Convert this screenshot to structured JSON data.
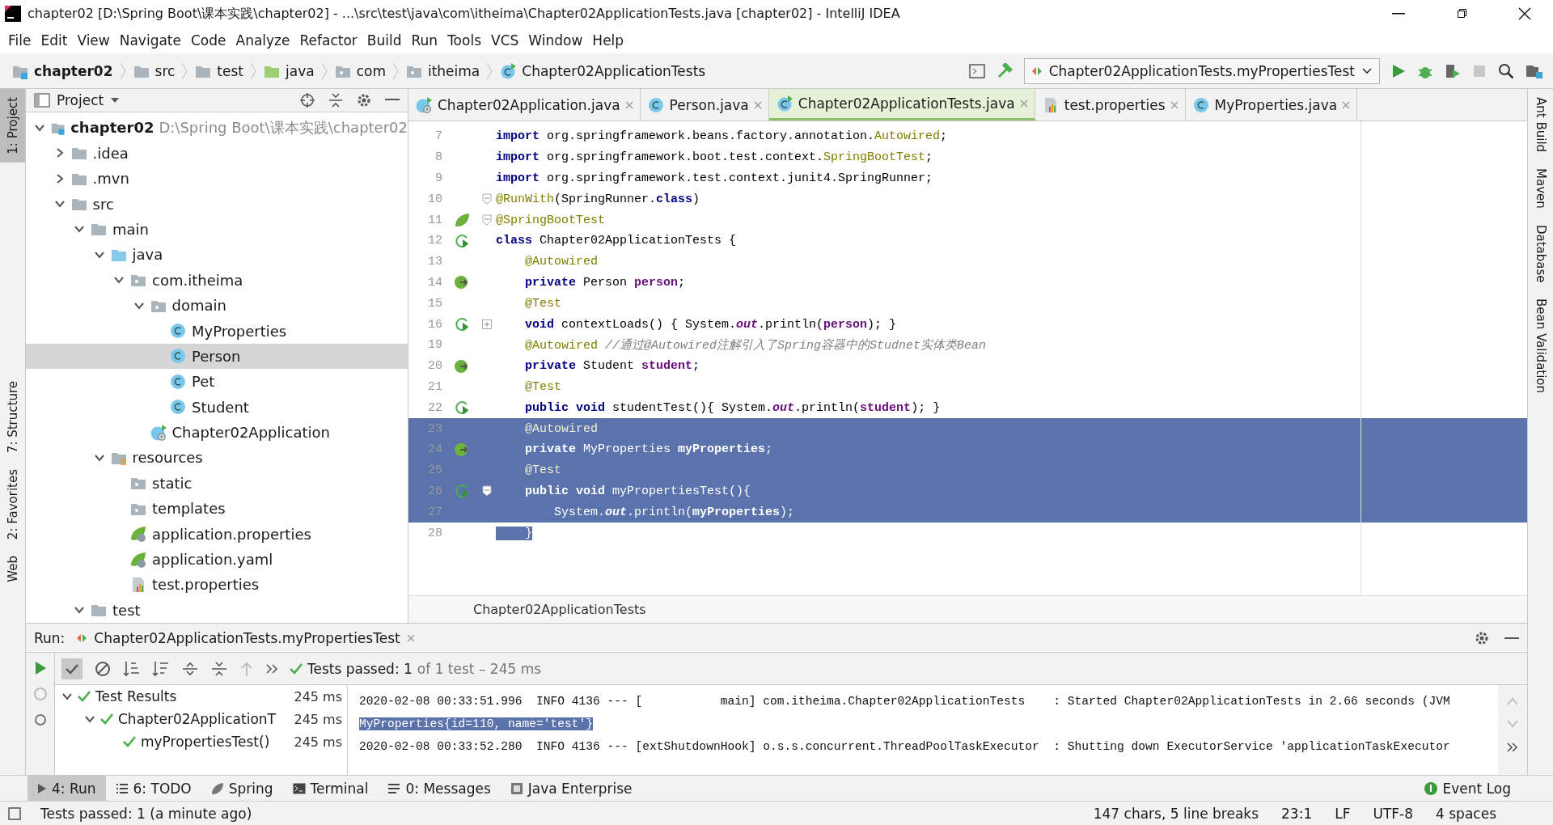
{
  "window": {
    "title": "chapter02 [D:\\Spring Boot\\课本实践\\chapter02] - ...\\src\\test\\java\\com\\itheima\\Chapter02ApplicationTests.java [chapter02] - IntelliJ IDEA"
  },
  "menu": [
    "File",
    "Edit",
    "View",
    "Navigate",
    "Code",
    "Analyze",
    "Refactor",
    "Build",
    "Run",
    "Tools",
    "VCS",
    "Window",
    "Help"
  ],
  "breadcrumbs": [
    {
      "label": "chapter02",
      "kind": "module"
    },
    {
      "label": "src",
      "kind": "folder"
    },
    {
      "label": "test",
      "kind": "folder"
    },
    {
      "label": "java",
      "kind": "testfolder"
    },
    {
      "label": "com",
      "kind": "package"
    },
    {
      "label": "itheima",
      "kind": "package"
    },
    {
      "label": "Chapter02ApplicationTests",
      "kind": "testclass"
    }
  ],
  "run_config": "Chapter02ApplicationTests.myPropertiesTest",
  "left_tools": [
    {
      "label": "1: Project",
      "selected": true
    },
    {
      "label": "7: Structure",
      "selected": false
    },
    {
      "label": "2: Favorites",
      "selected": false
    },
    {
      "label": "Web",
      "selected": false
    }
  ],
  "right_tools": [
    "Ant Build",
    "Maven",
    "Database",
    "Bean Validation"
  ],
  "project": {
    "title": "Project",
    "tree": [
      {
        "label": "chapter02",
        "hint": "D:\\Spring Boot\\课本实践\\chapter02",
        "kind": "module",
        "expanded": true,
        "selected": false,
        "children": [
          {
            "label": ".idea",
            "kind": "folder",
            "expanded": false,
            "selected": false
          },
          {
            "label": ".mvn",
            "kind": "folder",
            "expanded": false,
            "selected": false
          },
          {
            "label": "src",
            "kind": "folder",
            "expanded": true,
            "selected": false,
            "children": [
              {
                "label": "main",
                "kind": "folder",
                "expanded": true,
                "selected": false,
                "children": [
                  {
                    "label": "java",
                    "kind": "sourcefolder",
                    "expanded": true,
                    "selected": false,
                    "children": [
                      {
                        "label": "com.itheima",
                        "kind": "package",
                        "expanded": true,
                        "selected": false,
                        "children": [
                          {
                            "label": "domain",
                            "kind": "package",
                            "expanded": true,
                            "selected": false,
                            "children": [
                              {
                                "label": "MyProperties",
                                "kind": "class",
                                "selected": false
                              },
                              {
                                "label": "Person",
                                "kind": "class",
                                "selected": true
                              },
                              {
                                "label": "Pet",
                                "kind": "class",
                                "selected": false
                              },
                              {
                                "label": "Student",
                                "kind": "class",
                                "selected": false
                              }
                            ]
                          },
                          {
                            "label": "Chapter02Application",
                            "kind": "springclass",
                            "selected": false
                          }
                        ]
                      }
                    ]
                  },
                  {
                    "label": "resources",
                    "kind": "resources",
                    "expanded": true,
                    "selected": false,
                    "children": [
                      {
                        "label": "static",
                        "kind": "package",
                        "selected": false
                      },
                      {
                        "label": "templates",
                        "kind": "package",
                        "selected": false
                      },
                      {
                        "label": "application.properties",
                        "kind": "springconfig",
                        "selected": false
                      },
                      {
                        "label": "application.yaml",
                        "kind": "springconfig",
                        "selected": false
                      },
                      {
                        "label": "test.properties",
                        "kind": "properties",
                        "selected": false
                      }
                    ]
                  }
                ]
              },
              {
                "label": "test",
                "kind": "folder",
                "expanded": true,
                "selected": false
              }
            ]
          }
        ]
      }
    ]
  },
  "editor": {
    "tabs": [
      {
        "label": "Chapter02Application.java",
        "kind": "springclass",
        "selected": false
      },
      {
        "label": "Person.java",
        "kind": "class",
        "selected": false
      },
      {
        "label": "Chapter02ApplicationTests.java",
        "kind": "testclass",
        "selected": true
      },
      {
        "label": "test.properties",
        "kind": "properties",
        "selected": false
      },
      {
        "label": "MyProperties.java",
        "kind": "class",
        "selected": false
      }
    ],
    "lines": [
      {
        "number": "7",
        "selected": false,
        "tokens": [
          {
            "kind": "kw",
            "text": "import"
          },
          {
            "kind": "plain",
            "text": " org.springframework.beans.factory.annotation."
          },
          {
            "kind": "ann",
            "text": "Autowired"
          },
          {
            "kind": "plain",
            "text": ";"
          }
        ]
      },
      {
        "number": "8",
        "selected": false,
        "tokens": [
          {
            "kind": "kw",
            "text": "import"
          },
          {
            "kind": "plain",
            "text": " org.springframework.boot.test.context."
          },
          {
            "kind": "ann",
            "text": "SpringBootTest"
          },
          {
            "kind": "plain",
            "text": ";"
          }
        ]
      },
      {
        "number": "9",
        "selected": false,
        "tokens": [
          {
            "kind": "kw",
            "text": "import"
          },
          {
            "kind": "plain",
            "text": " org.springframework.test.context.junit4.SpringRunner;"
          }
        ]
      },
      {
        "number": "10",
        "selected": false,
        "expanded": true,
        "tokens": [
          {
            "kind": "ann",
            "text": "@RunWith"
          },
          {
            "kind": "plain",
            "text": "(SpringRunner."
          },
          {
            "kind": "kw",
            "text": "class"
          },
          {
            "kind": "plain",
            "text": ")"
          }
        ]
      },
      {
        "number": "11",
        "selected": false,
        "kind": "spring",
        "expanded": true,
        "tokens": [
          {
            "kind": "ann",
            "text": "@SpringBootTest"
          }
        ]
      },
      {
        "number": "12",
        "selected": false,
        "kind": "run",
        "tokens": [
          {
            "kind": "kw",
            "text": "class"
          },
          {
            "kind": "plain",
            "text": " Chapter02ApplicationTests {"
          }
        ]
      },
      {
        "number": "13",
        "selected": false,
        "tokens": [
          {
            "kind": "ann",
            "text": "    @Autowired"
          }
        ]
      },
      {
        "number": "14",
        "selected": false,
        "kind": "bean",
        "tokens": [
          {
            "kind": "kw",
            "text": "    private"
          },
          {
            "kind": "plain",
            "text": " Person "
          },
          {
            "kind": "field",
            "text": "person"
          },
          {
            "kind": "plain",
            "text": ";"
          }
        ]
      },
      {
        "number": "15",
        "selected": false,
        "tokens": [
          {
            "kind": "ann",
            "text": "    @Test"
          }
        ]
      },
      {
        "number": "16",
        "selected": false,
        "kind": "run",
        "expanded": false,
        "tokens": [
          {
            "kind": "kw",
            "text": "    void"
          },
          {
            "kind": "plain",
            "text": " contextLoads() { System."
          },
          {
            "kind": "static",
            "text": "out"
          },
          {
            "kind": "plain",
            "text": ".println("
          },
          {
            "kind": "field",
            "text": "person"
          },
          {
            "kind": "plain",
            "text": "); }"
          }
        ]
      },
      {
        "number": "19",
        "selected": false,
        "tokens": [
          {
            "kind": "ann",
            "text": "    @Autowired"
          },
          {
            "kind": "comment",
            "text": " //通过@Autowired注解引入了Spring容器中的Studnet实体类Bean"
          }
        ]
      },
      {
        "number": "20",
        "selected": false,
        "kind": "bean",
        "tokens": [
          {
            "kind": "kw",
            "text": "    private"
          },
          {
            "kind": "plain",
            "text": " Student "
          },
          {
            "kind": "field",
            "text": "student"
          },
          {
            "kind": "plain",
            "text": ";"
          }
        ]
      },
      {
        "number": "21",
        "selected": false,
        "tokens": [
          {
            "kind": "ann",
            "text": "    @Test"
          }
        ]
      },
      {
        "number": "22",
        "selected": false,
        "kind": "run",
        "tokens": [
          {
            "kind": "kw",
            "text": "    public void"
          },
          {
            "kind": "plain",
            "text": " studentTest(){ System."
          },
          {
            "kind": "static",
            "text": "out"
          },
          {
            "kind": "plain",
            "text": ".println("
          },
          {
            "kind": "field",
            "text": "student"
          },
          {
            "kind": "plain",
            "text": "); }"
          }
        ]
      },
      {
        "number": "23",
        "selected": true,
        "tokens": [
          {
            "kind": "ann",
            "text": "    @Autowired"
          }
        ]
      },
      {
        "number": "24",
        "selected": true,
        "kind": "bean",
        "tokens": [
          {
            "kind": "kw",
            "text": "    private"
          },
          {
            "kind": "plain",
            "text": " MyProperties "
          },
          {
            "kind": "field",
            "text": "myProperties"
          },
          {
            "kind": "plain",
            "text": ";"
          }
        ]
      },
      {
        "number": "25",
        "selected": true,
        "tokens": [
          {
            "kind": "ann",
            "text": "    @Test"
          }
        ]
      },
      {
        "number": "26",
        "selected": true,
        "kind": "run",
        "expanded": true,
        "tokens": [
          {
            "kind": "kw",
            "text": "    public void"
          },
          {
            "kind": "plain",
            "text": " myPropertiesTest(){"
          }
        ]
      },
      {
        "number": "27",
        "selected": true,
        "tokens": [
          {
            "kind": "plain",
            "text": "        System."
          },
          {
            "kind": "static",
            "text": "out"
          },
          {
            "kind": "plain",
            "text": ".println("
          },
          {
            "kind": "field",
            "text": "myProperties"
          },
          {
            "kind": "plain",
            "text": ");"
          }
        ]
      },
      {
        "number": "28",
        "selected": true,
        "tokens": [
          {
            "kind": "plain",
            "text": "    }"
          }
        ]
      }
    ],
    "footer": "Chapter02ApplicationTests"
  },
  "run": {
    "label": "Run:",
    "tab": "Chapter02ApplicationTests.myPropertiesTest",
    "status": "Tests passed: 1",
    "status_detail": "of 1 test – 245 ms",
    "tests": [
      {
        "label": "Test Results",
        "time": "245 ms",
        "expanded": true,
        "children": [
          {
            "label": "Chapter02ApplicationT",
            "time": "245 ms",
            "expanded": true,
            "children": [
              {
                "label": "myPropertiesTest()",
                "time": "245 ms"
              }
            ]
          }
        ]
      }
    ],
    "console": [
      {
        "text": "2020-02-08 00:33:51.996  INFO 4136 --- [           main] com.itheima.Chapter02ApplicationTests    : Started Chapter02ApplicationTests in 2.66 seconds (JVM",
        "selected": false
      },
      {
        "text": "MyProperties{id=110, name='test'}",
        "selected": true
      },
      {
        "text": "2020-02-08 00:33:52.280  INFO 4136 --- [extShutdownHook] o.s.s.concurrent.ThreadPoolTaskExecutor  : Shutting down ExecutorService 'applicationTaskExecutor",
        "selected": false
      }
    ]
  },
  "tool_tabs": [
    {
      "label": "4: Run",
      "kind": "run",
      "selected": true
    },
    {
      "label": "6: TODO",
      "kind": "todo",
      "selected": false
    },
    {
      "label": "Spring",
      "kind": "spring",
      "selected": false
    },
    {
      "label": "Terminal",
      "kind": "terminal",
      "selected": false
    },
    {
      "label": "0: Messages",
      "kind": "messages",
      "selected": false
    },
    {
      "label": "Java Enterprise",
      "kind": "enterprise",
      "selected": false
    }
  ],
  "event_log": "Event Log",
  "status_bar": {
    "message": "Tests passed: 1 (a minute ago)",
    "items": [
      "147 chars, 5 line breaks",
      "23:1",
      "LF",
      "UTF-8",
      "4 spaces"
    ]
  }
}
